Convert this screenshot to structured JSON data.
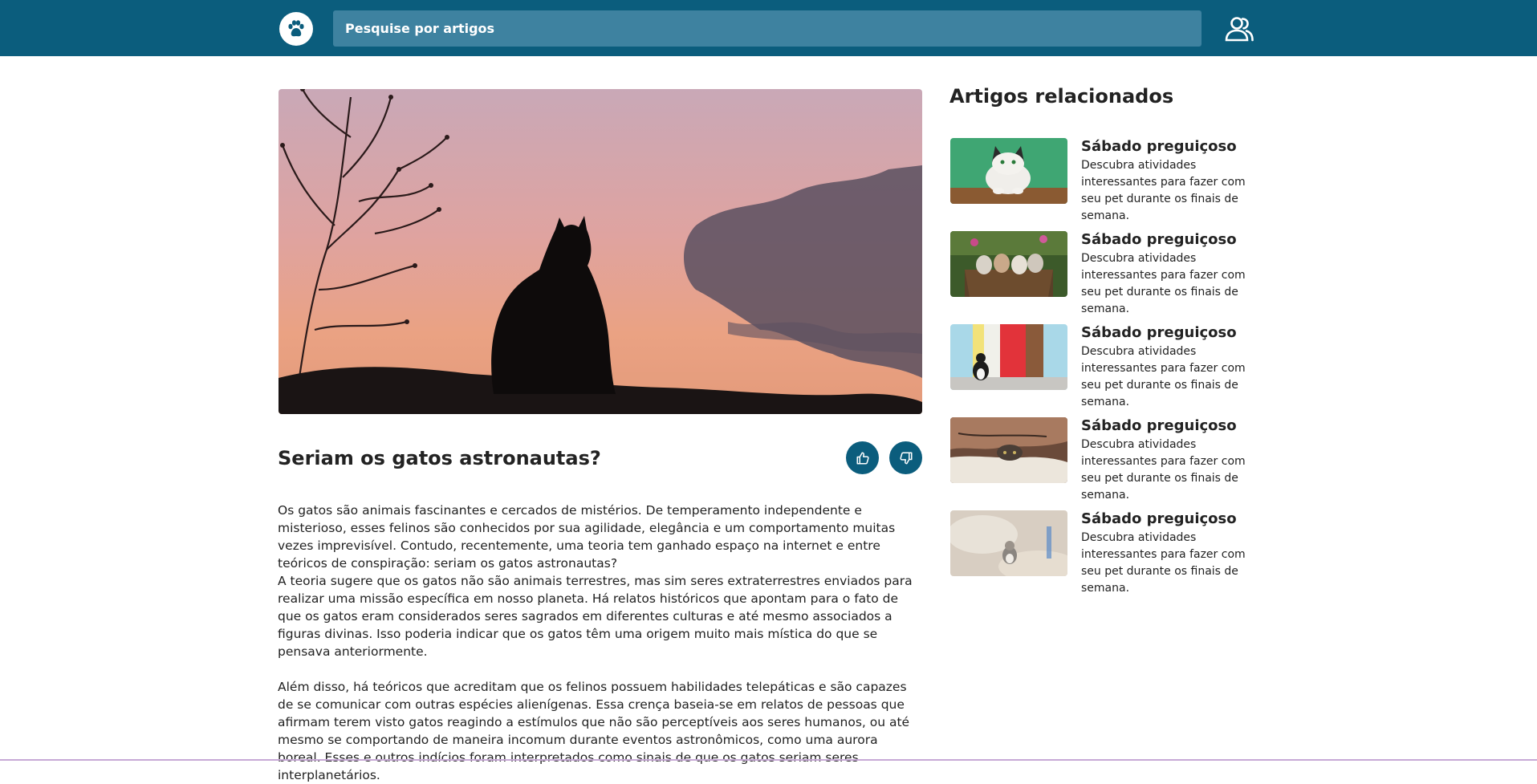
{
  "header": {
    "search_placeholder": "Pesquise por artigos",
    "logo_icon": "paw-icon",
    "user_icon": "users-icon",
    "brand_color": "#0b5d7d"
  },
  "article": {
    "title": "Seriam os gatos astronautas?",
    "hero_image": "cat-silhouette-sunset",
    "like_icon": "thumbs-up-icon",
    "dislike_icon": "thumbs-down-icon",
    "paragraphs": [
      "Os gatos são animais fascinantes e cercados de mistérios. De temperamento independente e misterioso, esses felinos são conhecidos por sua agilidade, elegância e um comportamento muitas vezes imprevisível. Contudo, recentemente, uma teoria tem ganhado espaço na internet e entre teóricos de conspiração: seriam os gatos astronautas?",
      "A teoria sugere que os gatos não são animais terrestres, mas sim seres extraterrestres enviados para realizar uma missão específica em nosso planeta. Há relatos históricos que apontam para o fato de que os gatos eram considerados seres sagrados em diferentes culturas e até mesmo associados a figuras divinas. Isso poderia indicar que os gatos têm uma origem muito mais mística do que se pensava anteriormente.",
      "Além disso, há teóricos que acreditam que os felinos possuem habilidades telepáticas e são capazes de se comunicar com outras espécies alienígenas. Essa crença baseia-se em relatos de pessoas que afirmam terem visto gatos reagindo a estímulos que não são perceptíveis aos seres humanos, ou até mesmo se comportando de maneira incomum durante eventos astronômicos, como uma aurora boreal. Esses e outros indícios foram interpretados como sinais de que os gatos seriam seres interplanetários."
    ]
  },
  "related": {
    "heading": "Artigos relacionados",
    "items": [
      {
        "title": "Sábado preguiçoso",
        "description": "Descubra atividades interessantes para fazer com seu pet durante os finais de semana.",
        "thumb": "cat-on-green-wall"
      },
      {
        "title": "Sábado preguiçoso",
        "description": "Descubra atividades interessantes para fazer com seu pet durante os finais de semana.",
        "thumb": "kittens-in-basket"
      },
      {
        "title": "Sábado preguiçoso",
        "description": "Descubra atividades interessantes para fazer com seu pet durante os finais de semana.",
        "thumb": "cat-by-colorful-wall"
      },
      {
        "title": "Sábado preguiçoso",
        "description": "Descubra atividades interessantes para fazer com seu pet durante os finais de semana.",
        "thumb": "cat-under-blanket"
      },
      {
        "title": "Sábado preguiçoso",
        "description": "Descubra atividades interessantes para fazer com seu pet durante os finais de semana.",
        "thumb": "kitten-on-pillow"
      }
    ]
  }
}
